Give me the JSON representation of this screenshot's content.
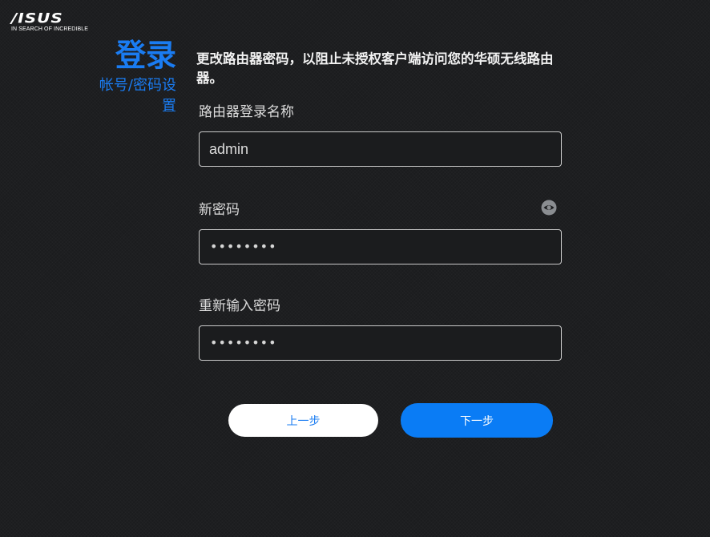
{
  "brand": {
    "logo_text": "/ISUS",
    "tagline": "IN SEARCH OF INCREDIBLE"
  },
  "sidebar": {
    "title": "登录",
    "subtitle": "帐号/密码设置"
  },
  "main": {
    "heading": "更改路由器密码，以阻止未授权客户端访问您的华硕无线路由器。",
    "fields": [
      {
        "label": "路由器登录名称",
        "value": "admin",
        "type": "text"
      },
      {
        "label": "新密码",
        "value": "••••••••",
        "type": "password"
      },
      {
        "label": "重新输入密码",
        "value": "••••••••",
        "type": "password"
      }
    ],
    "toggle_icon": "eye-icon"
  },
  "buttons": {
    "prev_label": "上一步",
    "next_label": "下一步"
  },
  "colors": {
    "accent": "#1a7cf2",
    "primary_button": "#0a7cf5",
    "background": "#1b1c1e"
  }
}
